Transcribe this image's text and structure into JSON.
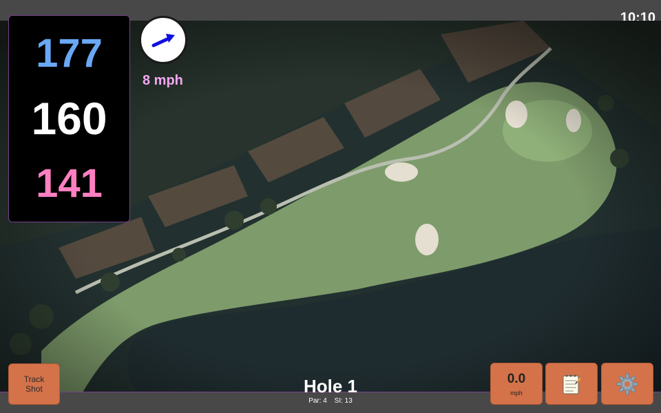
{
  "status_bar": {
    "time": "10:10"
  },
  "distances": {
    "back": "177",
    "middle": "160",
    "front": "141"
  },
  "wind": {
    "speed_label": "8 mph",
    "icon": "wind-arrow-icon",
    "arrow_color": "#1010e0"
  },
  "buttons": {
    "track_shot_line1": "Track",
    "track_shot_line2": "Shot",
    "speed_value": "0.0",
    "speed_unit": "mph",
    "notes_icon": "notepad-icon",
    "settings_icon": "gear-icon"
  },
  "hole": {
    "title": "Hole 1",
    "par": "Par: 4",
    "stroke_index": "SI: 13"
  },
  "colors": {
    "accent": "#d4724a",
    "distance_back": "#6aa8f5",
    "distance_front": "#ff7fc1",
    "wind_text": "#f4a7f3",
    "fairway": "#8fae7a",
    "water": "#223033"
  }
}
